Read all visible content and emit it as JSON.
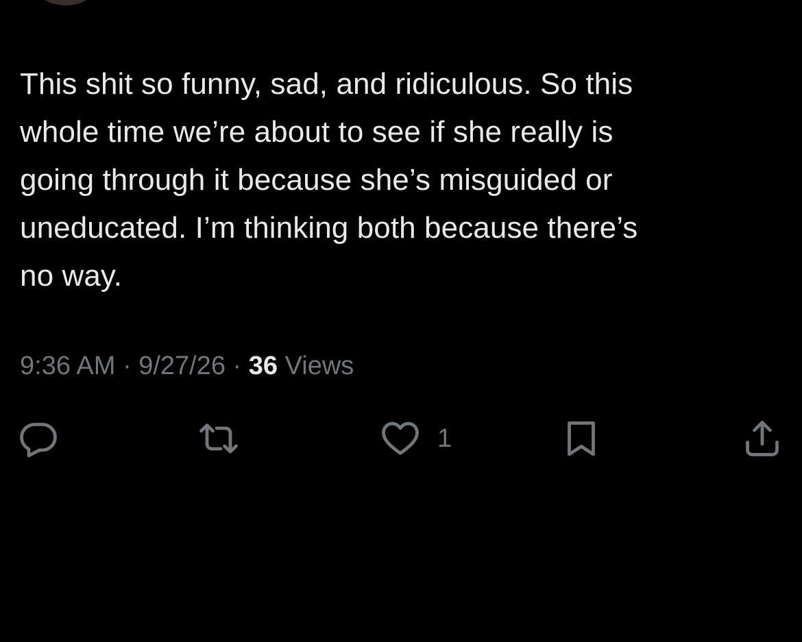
{
  "tweet": {
    "text": "This shit so funny, sad, and ridiculous. So this\nwhole time we’re about to see if she really is\ngoing through it because she’s misguided or\nuneducated. I’m thinking both because there’s\nno way."
  },
  "meta": {
    "time": "9:36 AM",
    "separator_1": " · ",
    "date": "9/27/26",
    "separator_2": " · ",
    "views_count": "36",
    "views_label": " Views"
  },
  "actions": {
    "reply_icon": "reply-icon",
    "retweet_icon": "retweet-icon",
    "like_icon": "heart-icon",
    "like_count": "1",
    "bookmark_icon": "bookmark-icon",
    "share_icon": "share-icon"
  },
  "colors": {
    "background": "#000000",
    "text": "#e7e9ea",
    "muted": "#71767b"
  }
}
